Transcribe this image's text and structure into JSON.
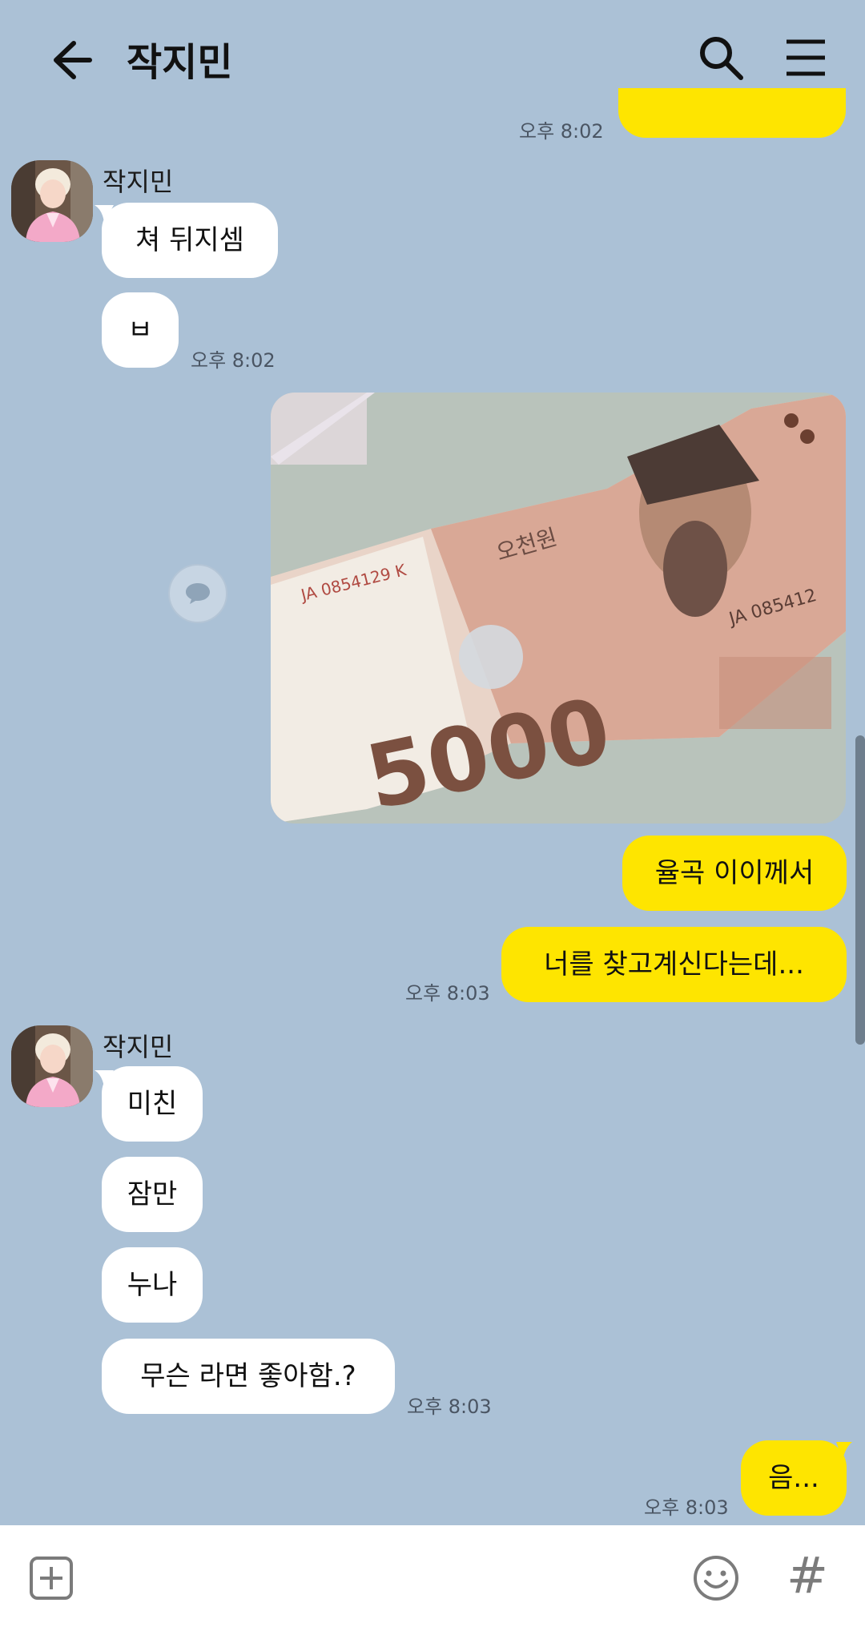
{
  "header": {
    "back_icon": "back-arrow-icon",
    "title": "작지민",
    "search_icon": "search-icon",
    "menu_icon": "hamburger-menu-icon"
  },
  "messages": {
    "ts_top": "오후 8:02",
    "sender1": "작지민",
    "m1": "쳐 뒤지셈",
    "m2": "ㅂ",
    "ts_m2": "오후 8:02",
    "photo_alt": "5000원 지폐 사진",
    "m3": "율곡 이이께서",
    "m4": "너를 찾고계신다는데...",
    "ts_m4": "오후 8:03",
    "sender2": "작지민",
    "m5": "미친",
    "m6": "잠만",
    "m7": "누나",
    "m8": "무슨 라면 좋아함.?",
    "ts_m8": "오후 8:03",
    "m9": "음...",
    "ts_m9": "오후 8:03"
  },
  "colors": {
    "background": "#abc1d6",
    "outgoing": "#fee500",
    "incoming": "#ffffff"
  },
  "composer": {
    "plus_icon": "plus-square-icon",
    "emoji_icon": "smile-emoji-icon",
    "hash_label": "#"
  }
}
